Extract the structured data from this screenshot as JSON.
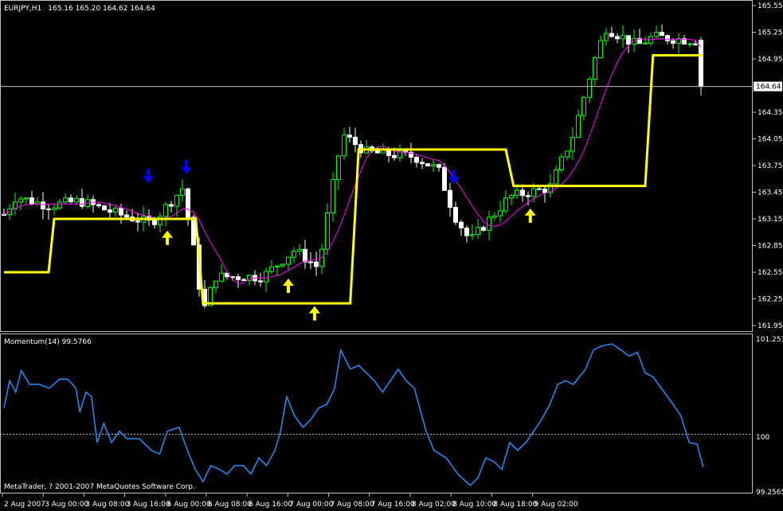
{
  "header": {
    "symbol": "EURJPY,H1",
    "ohlc": "165.16 165.20 164.62 164.64"
  },
  "indicator": {
    "label": "Momentum(14) 99.5766",
    "axis_top": "101.2533",
    "axis_mid": "100",
    "axis_bottom": "99.2565"
  },
  "copyright": "MetaTrader, ? 2001-2007 MetaQuotes Software Corp.",
  "price_axis": [
    "165.55",
    "165.25",
    "164.95",
    "164.35",
    "164.05",
    "163.75",
    "163.45",
    "163.15",
    "162.85",
    "162.55",
    "162.25",
    "161.95"
  ],
  "current_price": "164.64",
  "time_axis": [
    "2 Aug 2007",
    "3 Aug 00:00",
    "3 Aug 08:00",
    "3 Aug 16:00",
    "6 Aug 00:00",
    "6 Aug 08:00",
    "6 Aug 16:00",
    "7 Aug 00:00",
    "7 Aug 08:00",
    "7 Aug 16:00",
    "8 Aug 02:00",
    "8 Aug 10:00",
    "8 Aug 18:00",
    "9 Aug 02:00"
  ],
  "colors": {
    "bull": "#00ff00",
    "bear": "#ffffff",
    "stop": "#ffff00",
    "ma": "#ff00ff",
    "momentum": "#1e90ff",
    "down_arrow": "#0000ff",
    "up_arrow": "#ffff00"
  },
  "chart_data": {
    "type": "line",
    "price_range": [
      161.95,
      165.55
    ],
    "price_path": [
      [
        0,
        163.2
      ],
      [
        2.1,
        163.4
      ],
      [
        7.9,
        163.3
      ],
      [
        13.6,
        163.35
      ],
      [
        20.7,
        163.2
      ],
      [
        26.4,
        163.1
      ],
      [
        32.1,
        163.5
      ],
      [
        34.3,
        162.7
      ],
      [
        35.7,
        162.1
      ],
      [
        37.9,
        162.5
      ],
      [
        46.4,
        162.5
      ],
      [
        52.1,
        162.8
      ],
      [
        56.4,
        162.6
      ],
      [
        58.6,
        163.4
      ],
      [
        60.7,
        164.1
      ],
      [
        65,
        163.9
      ],
      [
        73.6,
        163.85
      ],
      [
        77.9,
        163.7
      ],
      [
        80.7,
        163.2
      ],
      [
        83.6,
        162.9
      ],
      [
        86.4,
        163.1
      ],
      [
        90.7,
        163.4
      ],
      [
        97.9,
        163.5
      ],
      [
        102.1,
        164.1
      ],
      [
        105.7,
        164.9
      ],
      [
        107.9,
        165.3
      ],
      [
        113.6,
        165.1
      ],
      [
        116.4,
        165.2
      ],
      [
        125,
        165.15
      ],
      [
        125.4,
        164.64
      ]
    ],
    "stop_levels": [
      [
        0,
        8,
        162.55
      ],
      [
        9,
        34.4,
        163.15
      ],
      [
        35.7,
        62.1,
        162.2
      ],
      [
        63.6,
        90,
        163.93
      ],
      [
        91.4,
        115,
        163.52
      ],
      [
        116.4,
        125.4,
        164.99
      ]
    ],
    "down_arrows": [
      [
        25.9,
        163.57
      ],
      [
        32.7,
        163.67
      ],
      [
        80.7,
        163.56
      ]
    ],
    "up_arrows": [
      [
        29.3,
        163.0
      ],
      [
        51,
        162.46
      ],
      [
        55.7,
        162.15
      ],
      [
        94.4,
        163.25
      ]
    ],
    "momentum_range": [
      99.2565,
      101.2533
    ],
    "momentum": [
      [
        0,
        100.34
      ],
      [
        1,
        100.7
      ],
      [
        2.1,
        100.55
      ],
      [
        3.1,
        100.83
      ],
      [
        4.6,
        100.65
      ],
      [
        6.4,
        100.65
      ],
      [
        8.1,
        100.6
      ],
      [
        10,
        100.72
      ],
      [
        11.4,
        100.72
      ],
      [
        12.9,
        100.6
      ],
      [
        13.6,
        100.29
      ],
      [
        14.7,
        100.55
      ],
      [
        15.7,
        100.49
      ],
      [
        16.7,
        99.89
      ],
      [
        17.9,
        100.14
      ],
      [
        19.3,
        99.89
      ],
      [
        20.7,
        100.04
      ],
      [
        22.1,
        99.94
      ],
      [
        24.3,
        99.94
      ],
      [
        26.4,
        99.79
      ],
      [
        27.9,
        99.74
      ],
      [
        29.3,
        100.04
      ],
      [
        31.4,
        100.09
      ],
      [
        32.9,
        99.79
      ],
      [
        34.3,
        99.54
      ],
      [
        35.7,
        99.38
      ],
      [
        37.1,
        99.59
      ],
      [
        38.6,
        99.54
      ],
      [
        40,
        99.48
      ],
      [
        41.4,
        99.59
      ],
      [
        42.9,
        99.59
      ],
      [
        44.3,
        99.48
      ],
      [
        45.7,
        99.69
      ],
      [
        47.1,
        99.59
      ],
      [
        48.6,
        99.79
      ],
      [
        49.6,
        100.04
      ],
      [
        50.7,
        100.49
      ],
      [
        52.1,
        100.24
      ],
      [
        53.6,
        100.09
      ],
      [
        55,
        100.19
      ],
      [
        56.4,
        100.34
      ],
      [
        57.9,
        100.39
      ],
      [
        59.3,
        100.6
      ],
      [
        60.4,
        101.1
      ],
      [
        62.1,
        100.85
      ],
      [
        63.6,
        100.9
      ],
      [
        65,
        100.8
      ],
      [
        66.4,
        100.7
      ],
      [
        67.9,
        100.55
      ],
      [
        69.3,
        100.7
      ],
      [
        70.7,
        100.85
      ],
      [
        72.1,
        100.7
      ],
      [
        73.6,
        100.6
      ],
      [
        75.7,
        100.04
      ],
      [
        77.1,
        99.79
      ],
      [
        79.3,
        99.69
      ],
      [
        81.4,
        99.48
      ],
      [
        83.6,
        99.33
      ],
      [
        85,
        99.43
      ],
      [
        86.4,
        99.69
      ],
      [
        87.9,
        99.64
      ],
      [
        89.3,
        99.54
      ],
      [
        90.7,
        99.89
      ],
      [
        92.1,
        99.79
      ],
      [
        93.6,
        99.89
      ],
      [
        95,
        100.04
      ],
      [
        96.4,
        100.19
      ],
      [
        97.9,
        100.39
      ],
      [
        99.3,
        100.65
      ],
      [
        100.7,
        100.7
      ],
      [
        102.1,
        100.65
      ],
      [
        104.3,
        100.85
      ],
      [
        105.7,
        101.1
      ],
      [
        107.1,
        101.15
      ],
      [
        109,
        101.18
      ],
      [
        110.7,
        101.1
      ],
      [
        112.1,
        101.02
      ],
      [
        113.6,
        101.07
      ],
      [
        115,
        100.8
      ],
      [
        116.4,
        100.75
      ],
      [
        117.9,
        100.6
      ],
      [
        120,
        100.39
      ],
      [
        121.4,
        100.24
      ],
      [
        122.9,
        99.89
      ],
      [
        124.3,
        99.87
      ],
      [
        125.4,
        99.57
      ]
    ]
  }
}
